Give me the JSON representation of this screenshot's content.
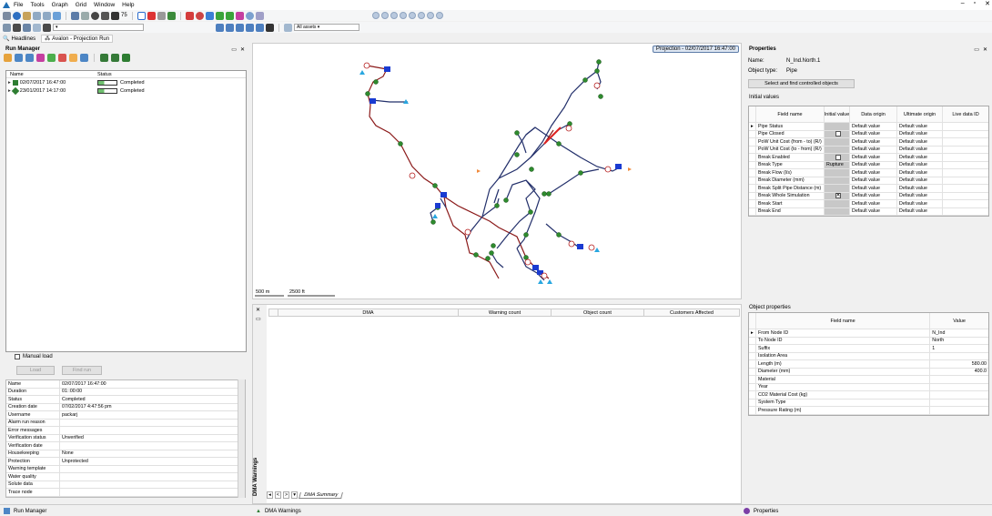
{
  "menu": [
    "File",
    "Tools",
    "Graph",
    "Grid",
    "Window",
    "Help"
  ],
  "toolbar": {
    "zoom_value": "75",
    "assets_label": "All assets"
  },
  "tabs": [
    "Headlines",
    "Avalon - Projection Run"
  ],
  "run_manager": {
    "title": "Run Manager",
    "columns": [
      "Name",
      "Status"
    ],
    "runs": [
      {
        "name": "02/07/2017 16:47:00",
        "status": "Completed"
      },
      {
        "name": "23/01/2017 14:17:00",
        "status": "Completed"
      }
    ],
    "manual_load_label": "Manual load",
    "load_button": "Load",
    "find_run_button": "Find run",
    "details": [
      {
        "key": "Name",
        "value": "02/07/2017 16:47:00"
      },
      {
        "key": "Duration",
        "value": "01::00:00"
      },
      {
        "key": "Status",
        "value": "Completed"
      },
      {
        "key": "Creation date",
        "value": "07/02/2017 4:47:56 pm"
      },
      {
        "key": "Username",
        "value": "packarj"
      },
      {
        "key": "Alarm run reason",
        "value": ""
      },
      {
        "key": "Error messages",
        "value": ""
      },
      {
        "key": "Verification status",
        "value": "Unverified"
      },
      {
        "key": "Verification date",
        "value": ""
      },
      {
        "key": "Housekeeping",
        "value": "None"
      },
      {
        "key": "Protection",
        "value": "Unprotected"
      },
      {
        "key": "Warning template",
        "value": ""
      },
      {
        "key": "Water quality",
        "value": ""
      },
      {
        "key": "Solute data",
        "value": ""
      },
      {
        "key": "Trace node",
        "value": ""
      }
    ]
  },
  "map": {
    "title": "Projection - 02/07/2017 16:47:00",
    "scale_m": "500 m",
    "scale_ft": "2500 ft"
  },
  "dma": {
    "side_label": "DMA Warnings",
    "columns": [
      "DMA",
      "Warning count",
      "Object count",
      "Customers Affected"
    ],
    "tab_label": "DMA Summary"
  },
  "properties": {
    "title": "Properties",
    "name_label": "Name:",
    "name_value": "N_Ind.North.1",
    "type_label": "Object type:",
    "type_value": "Pipe",
    "select_button": "Select and find controlled objects",
    "initial_values_label": "Initial values",
    "iv_columns": [
      "Field name",
      "Initial value",
      "Data origin",
      "Ultimate origin",
      "Live data ID"
    ],
    "iv_rows": [
      {
        "field": "Pipe Status",
        "value": "",
        "origin": "Default value",
        "ultimate": "Default value"
      },
      {
        "field": "Pipe Closed",
        "value": "",
        "origin": "Default value",
        "ultimate": "Default value"
      },
      {
        "field": "PoW Unit Cost (from - to) (R/)",
        "value": "",
        "origin": "Default value",
        "ultimate": "Default value"
      },
      {
        "field": "PoW Unit Cost (to - from) (R/)",
        "value": "",
        "origin": "Default value",
        "ultimate": "Default value"
      },
      {
        "field": "Break Enabled",
        "value": "",
        "origin": "Default value",
        "ultimate": "Default value"
      },
      {
        "field": "Break Type",
        "value": "Rupture",
        "origin": "Default value",
        "ultimate": "Default value"
      },
      {
        "field": "Break Flow (l/s)",
        "value": "",
        "origin": "Default value",
        "ultimate": "Default value"
      },
      {
        "field": "Break Diameter (mm)",
        "value": "",
        "origin": "Default value",
        "ultimate": "Default value"
      },
      {
        "field": "Break Split Pipe Distance (m)",
        "value": "",
        "origin": "Default value",
        "ultimate": "Default value"
      },
      {
        "field": "Break Whole Simulation",
        "value": "",
        "origin": "Default value",
        "ultimate": "Default value"
      },
      {
        "field": "Break Start",
        "value": "",
        "origin": "Default value",
        "ultimate": "Default value"
      },
      {
        "field": "Break End",
        "value": "",
        "origin": "Default value",
        "ultimate": "Default value"
      }
    ],
    "object_props_label": "Object properties",
    "op_columns": [
      "Field name",
      "Value"
    ],
    "op_rows": [
      {
        "field": "From Node ID",
        "value": "N_Ind"
      },
      {
        "field": "To Node ID",
        "value": "North"
      },
      {
        "field": "Suffix",
        "value": "1"
      },
      {
        "field": "Isolation Area",
        "value": ""
      },
      {
        "field": "Length (m)",
        "value": "580.00"
      },
      {
        "field": "Diameter (mm)",
        "value": "400.0"
      },
      {
        "field": "Material",
        "value": ""
      },
      {
        "field": "Year",
        "value": ""
      },
      {
        "field": "CO2 Material Cost (kg)",
        "value": ""
      },
      {
        "field": "System Type",
        "value": ""
      },
      {
        "field": "Pressure Rating (m)",
        "value": ""
      }
    ]
  },
  "statusbar": {
    "run_manager": "Run Manager",
    "dma_warnings": "DMA Warnings",
    "properties": "Properties"
  }
}
